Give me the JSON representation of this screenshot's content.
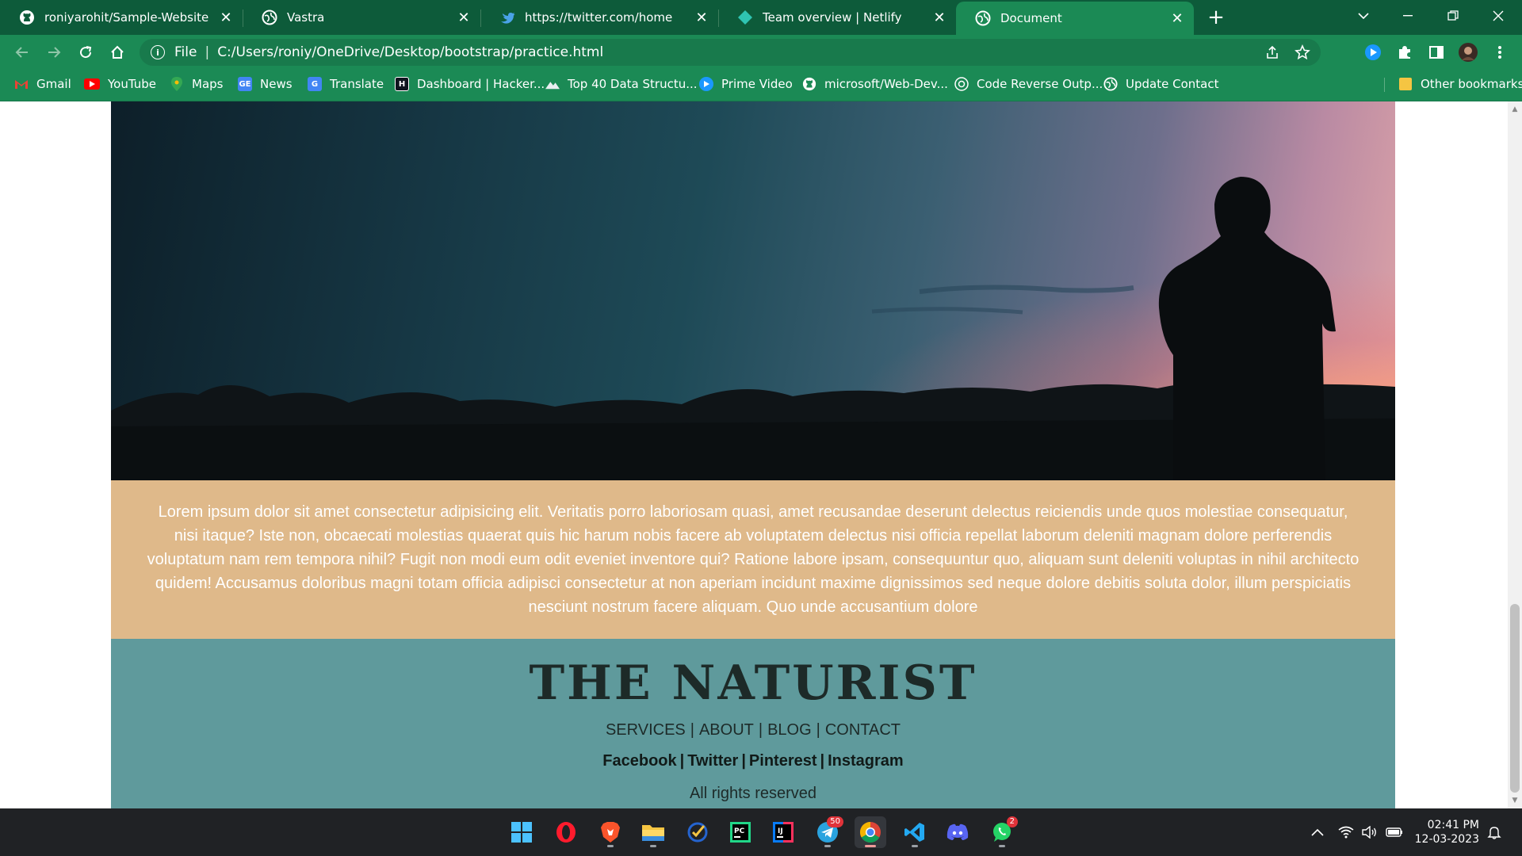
{
  "browser": {
    "tabs": [
      {
        "title": "roniyarohit/Sample-Website",
        "icon": "github-icon"
      },
      {
        "title": "Vastra",
        "icon": "globe-icon"
      },
      {
        "title": "https://twitter.com/home",
        "icon": "twitter-icon"
      },
      {
        "title": "Team overview | Netlify",
        "icon": "netlify-icon"
      },
      {
        "title": "Document",
        "icon": "globe-icon",
        "active": true
      }
    ],
    "address": {
      "scheme": "File",
      "url": "C:/Users/roniy/OneDrive/Desktop/bootstrap/practice.html"
    },
    "bookmarks": [
      {
        "label": "Gmail",
        "icon": "gmail-icon"
      },
      {
        "label": "YouTube",
        "icon": "youtube-icon"
      },
      {
        "label": "Maps",
        "icon": "maps-icon"
      },
      {
        "label": "News",
        "icon": "news-icon"
      },
      {
        "label": "Translate",
        "icon": "translate-icon"
      },
      {
        "label": "Dashboard | Hacker...",
        "icon": "hackerrank-icon"
      },
      {
        "label": "Top 40 Data Structu...",
        "icon": "mountain-icon"
      },
      {
        "label": "Prime Video",
        "icon": "prime-video-icon"
      },
      {
        "label": "microsoft/Web-Dev...",
        "icon": "github-icon"
      },
      {
        "label": "Code Reverse Outp...",
        "icon": "openai-icon"
      },
      {
        "label": "Update Contact",
        "icon": "globe-icon"
      }
    ],
    "other_bookmarks": "Other bookmarks"
  },
  "page": {
    "paragraph": "Lorem ipsum dolor sit amet consectetur adipisicing elit. Veritatis porro laboriosam quasi, amet recusandae deserunt delectus reiciendis unde quos molestiae consequatur, nisi itaque? Iste non, obcaecati molestias quaerat quis hic harum nobis facere ab voluptatem delectus nisi officia repellat laborum deleniti magnam dolore perferendis voluptatum nam rem tempora nihil? Fugit non modi eum odit eveniet inventore qui? Ratione labore ipsam, consequuntur quo, aliquam sunt deleniti voluptas in nihil architecto quidem! Accusamus doloribus magni totam officia adipisci consectetur at non aperiam incidunt maxime dignissimos sed neque dolore debitis soluta dolor, illum perspiciatis nesciunt nostrum facere aliquam. Quo unde accusantium dolore",
    "footer": {
      "brand": "THE NATURIST",
      "nav": [
        "SERVICES",
        "ABOUT",
        "BLOG",
        "CONTACT"
      ],
      "social": [
        "Facebook",
        "Twitter",
        "Pinterest",
        "Instagram"
      ],
      "rights": "All rights reserved"
    }
  },
  "taskbar": {
    "apps": [
      "windows-start-icon",
      "opera-icon",
      "brave-icon",
      "file-explorer-icon",
      "todo-icon",
      "pycharm-icon",
      "intellij-icon",
      "telegram-icon",
      "chrome-icon",
      "vscode-icon",
      "discord-icon",
      "whatsapp-icon"
    ],
    "badges": {
      "telegram": "50",
      "whatsapp": "2"
    },
    "time": "02:41 PM",
    "date": "12-03-2023"
  },
  "colors": {
    "chrome_dark": "#0d5b3a",
    "chrome_light": "#1b8a55",
    "paragraph_bg": "#dfb98a",
    "footer_bg": "#5f9a9c"
  }
}
